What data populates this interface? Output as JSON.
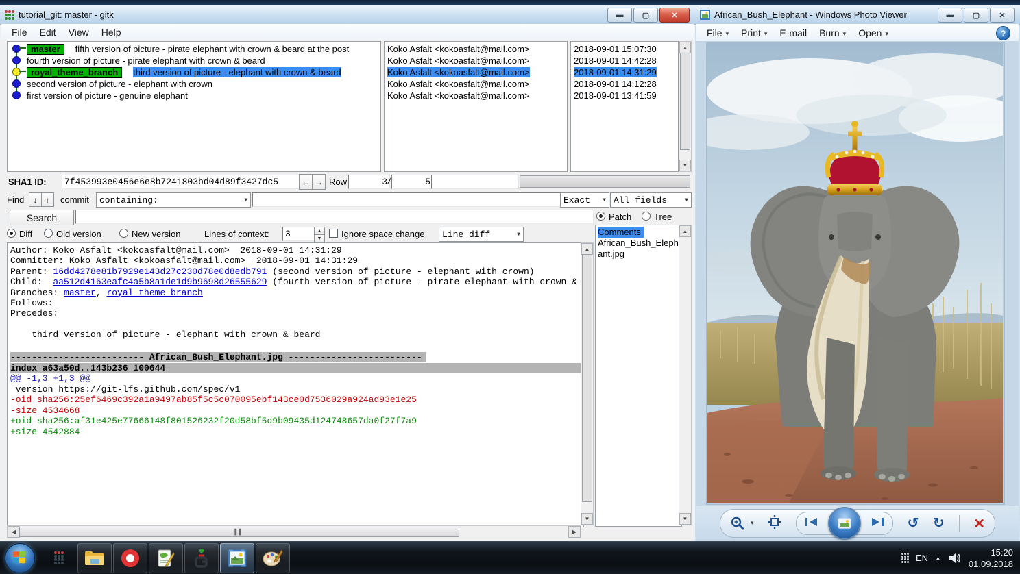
{
  "colors": {
    "selection": "#3b8df2",
    "badge_green": "#00b200",
    "link_blue": "#0000d7",
    "diff_minus": "#c40000",
    "diff_plus": "#0a8a0a",
    "hunk_blue": "#1a1aad",
    "filesep_gray": "#b4b4b4",
    "taskbar_dark": "#10151b"
  },
  "gitk": {
    "title": "tutorial_git: master - gitk",
    "menu": [
      "File",
      "Edit",
      "View",
      "Help"
    ],
    "commits": [
      {
        "badge": "master",
        "subject": "fifth version of picture - pirate elephant with crown & beard at the post",
        "author": "Koko Asfalt <kokoasfalt@mail.com>",
        "date": "2018-09-01 15:07:30",
        "dot": "blue",
        "selected": false
      },
      {
        "badge": "",
        "subject": "fourth version of picture - pirate elephant with crown & beard",
        "author": "Koko Asfalt <kokoasfalt@mail.com>",
        "date": "2018-09-01 14:42:28",
        "dot": "blue",
        "selected": false
      },
      {
        "badge": "royal_theme_branch",
        "subject": "third version of picture - elephant with crown & beard",
        "author": "Koko Asfalt <kokoasfalt@mail.com>",
        "date": "2018-09-01 14:31:29",
        "dot": "yellow",
        "selected": true
      },
      {
        "badge": "",
        "subject": "second version of picture - elephant with crown",
        "author": "Koko Asfalt <kokoasfalt@mail.com>",
        "date": "2018-09-01 14:12:28",
        "dot": "blue",
        "selected": false
      },
      {
        "badge": "",
        "subject": "first version of picture - genuine elephant",
        "author": "Koko Asfalt <kokoasfalt@mail.com>",
        "date": "2018-09-01 13:41:59",
        "dot": "blue",
        "selected": false
      }
    ],
    "sha1_row": {
      "label": "SHA1 ID:",
      "value": "7f453993e0456e6e8b7241803bd04d89f3427dc5",
      "row_label": "Row",
      "row_current": "3",
      "row_separator": "/",
      "row_total": "5"
    },
    "find_row": {
      "find_label": "Find",
      "commit_label": "commit",
      "containing": "containing:",
      "search_value": "",
      "exact": "Exact",
      "all_fields": "All fields"
    },
    "search_button": "Search",
    "diff_controls": {
      "diff": "Diff",
      "old_version": "Old version",
      "new_version": "New version",
      "lines_label": "Lines of context:",
      "lines_value": "3",
      "ignore_label": "Ignore space change",
      "line_diff": "Line diff"
    },
    "right_panel": {
      "patch": "Patch",
      "tree": "Tree",
      "items": [
        {
          "label": "Comments",
          "selected": true
        },
        {
          "label": "African_Bush_Elephant.jpg",
          "selected": false
        }
      ]
    },
    "details": [
      {
        "cls": "",
        "segs": [
          {
            "t": "Author: Koko Asfalt <kokoasfalt@mail.com>  2018-09-01 14:31:29"
          }
        ]
      },
      {
        "cls": "",
        "segs": [
          {
            "t": "Committer: Koko Asfalt <kokoasfalt@mail.com>  2018-09-01 14:31:29"
          }
        ]
      },
      {
        "cls": "",
        "segs": [
          {
            "t": "Parent: "
          },
          {
            "t": "16dd4278e81b7929e143d27c230d78e0d8edb791",
            "c": "link"
          },
          {
            "t": " (second version of picture - elephant with crown)"
          }
        ]
      },
      {
        "cls": "",
        "segs": [
          {
            "t": "Child:  "
          },
          {
            "t": "aa512d4163eafc4a5b8a1de1d9b9698d26555629",
            "c": "link"
          },
          {
            "t": " (fourth version of picture - pirate elephant with crown & beard)"
          }
        ]
      },
      {
        "cls": "",
        "segs": [
          {
            "t": "Branches: "
          },
          {
            "t": "master",
            "c": "link"
          },
          {
            "t": ", "
          },
          {
            "t": "royal_theme_branch",
            "c": "link"
          }
        ]
      },
      {
        "cls": "",
        "segs": [
          {
            "t": "Follows: "
          }
        ]
      },
      {
        "cls": "",
        "segs": [
          {
            "t": "Precedes: "
          }
        ]
      },
      {
        "cls": "",
        "segs": [
          {
            "t": " "
          }
        ]
      },
      {
        "cls": "",
        "segs": [
          {
            "t": "    third version of picture - elephant with crown & beard"
          }
        ]
      },
      {
        "cls": "",
        "segs": [
          {
            "t": " "
          }
        ]
      },
      {
        "cls": "filesep",
        "segs": [
          {
            "t": "------------------------- African_Bush_Elephant.jpg -------------------------"
          }
        ]
      },
      {
        "cls": "filesep-wide",
        "segs": [
          {
            "t": "index a63a50d..143b236 100644"
          }
        ]
      },
      {
        "cls": "hunk",
        "segs": [
          {
            "t": "@@ -1,3 +1,3 @@"
          }
        ]
      },
      {
        "cls": "",
        "segs": [
          {
            "t": " version https://git-lfs.github.com/spec/v1"
          }
        ]
      },
      {
        "cls": "minus",
        "segs": [
          {
            "t": "-oid sha256:25ef6469c392a1a9497ab85f5c5c070095ebf143ce0d7536029a924ad93e1e25"
          }
        ]
      },
      {
        "cls": "minus",
        "segs": [
          {
            "t": "-size 4534668"
          }
        ]
      },
      {
        "cls": "plus",
        "segs": [
          {
            "t": "+oid sha256:af31e425e77666148f801526232f20d58bf5d9b09435d124748657da0f27f7a9"
          }
        ]
      },
      {
        "cls": "plus",
        "segs": [
          {
            "t": "+size 4542884"
          }
        ]
      }
    ]
  },
  "photo_viewer": {
    "title": "African_Bush_Elephant - Windows Photo Viewer",
    "menu": [
      {
        "label": "File",
        "caret": true
      },
      {
        "label": "Print",
        "caret": true
      },
      {
        "label": "E-mail",
        "caret": false
      },
      {
        "label": "Burn",
        "caret": true
      },
      {
        "label": "Open",
        "caret": true
      }
    ],
    "help_glyph": "?",
    "toolbar": [
      "zoom",
      "fit-to-window",
      "previous",
      "slideshow",
      "next",
      "rotate-counterclockwise",
      "rotate-clockwise",
      "delete"
    ]
  },
  "taskbar": {
    "apps": [
      "gitk",
      "windows-explorer",
      "opera",
      "notepad-plus-plus",
      "git-gui",
      "windows-photo-viewer",
      "paint"
    ],
    "active_app": "windows-photo-viewer",
    "tray": {
      "language": "EN",
      "time": "15:20",
      "date": "01.09.2018"
    }
  }
}
